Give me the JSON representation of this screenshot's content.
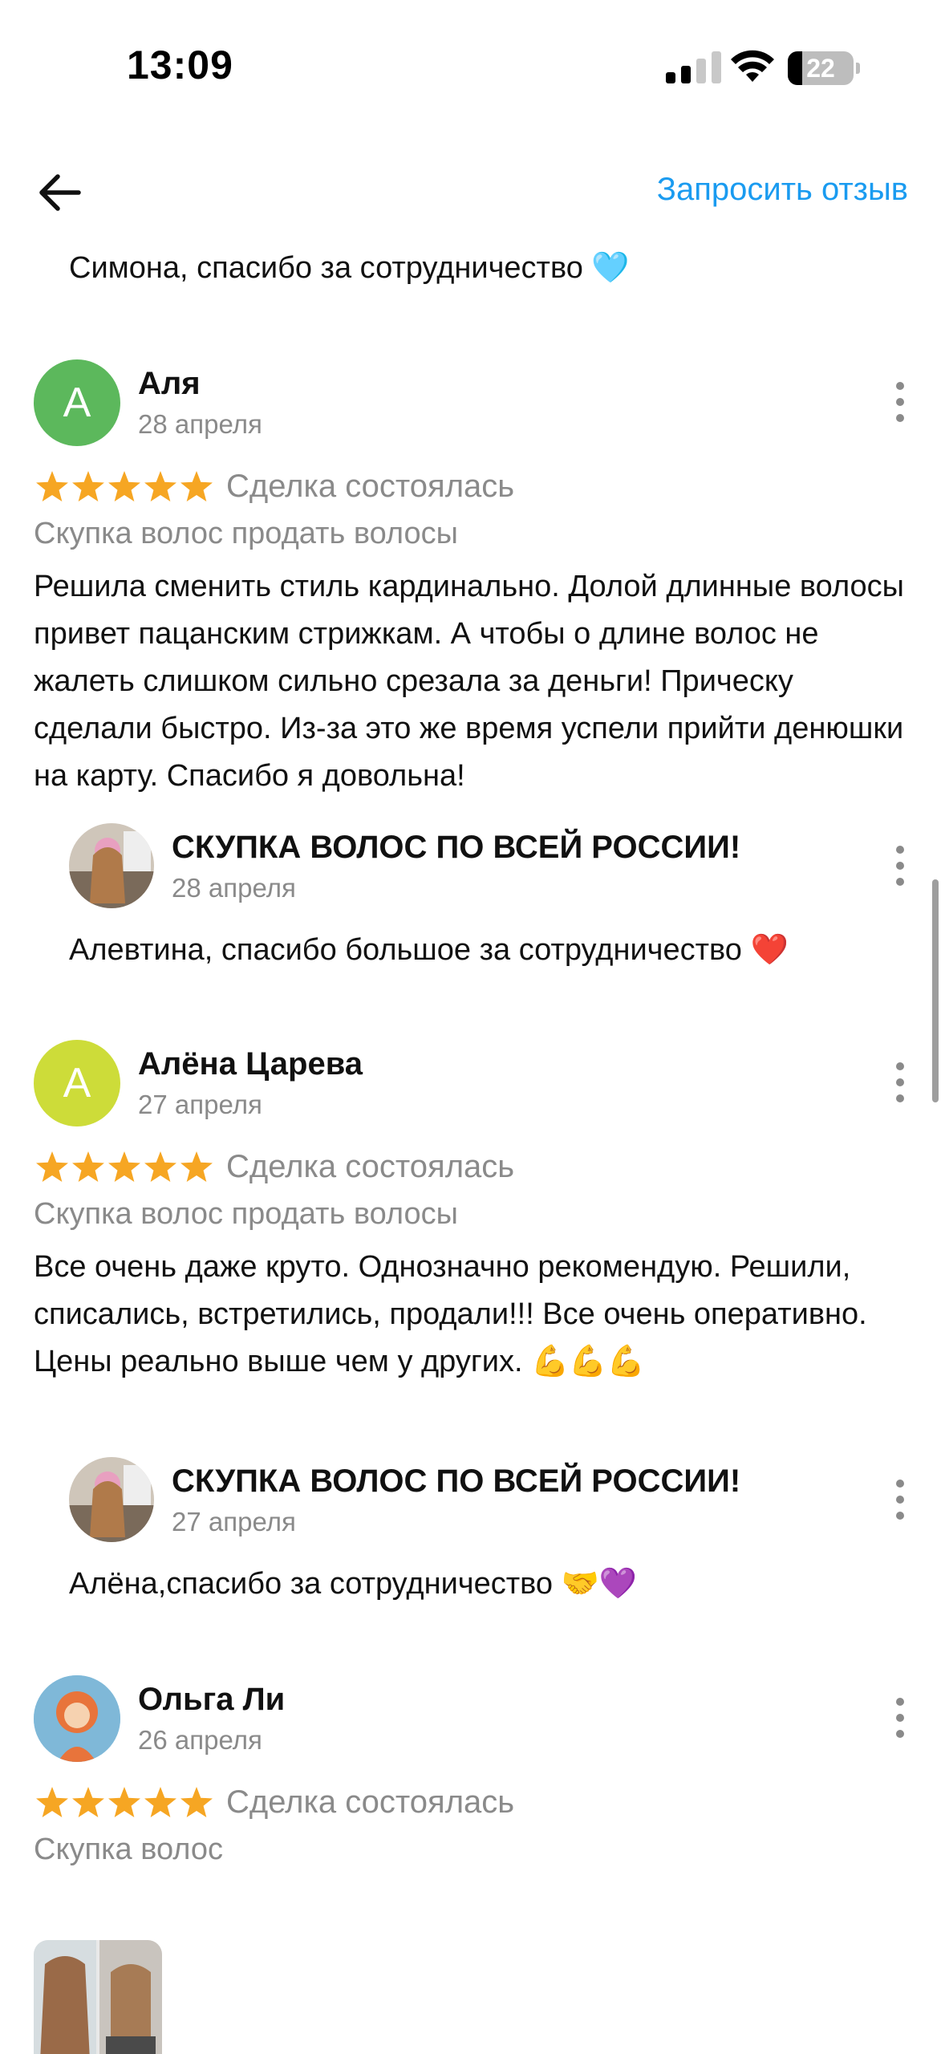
{
  "status_bar": {
    "time": "13:09",
    "battery": "22",
    "battery_level": 0.22
  },
  "header": {
    "back_icon": "arrow-left-icon",
    "request_review": "Запросить отзыв"
  },
  "previous_reply_tail": "Симона, спасибо за сотрудничество 🩵",
  "colors": {
    "accent": "#1a9bf0",
    "star": "#f6a623",
    "muted": "#8a8a8a"
  },
  "reviews": [
    {
      "avatar_letter": "А",
      "avatar_color": "#5cb85c",
      "author": "Аля",
      "date": "28 апреля",
      "rating": 5,
      "status": "Сделка состоялась",
      "service": "Скупка волос продать волосы",
      "text": "Решила сменить стиль кардинально. Долой длинные волосы привет пацанским стрижкам. А чтобы о длине волос не жалеть слишком сильно срезала за деньги! Прическу сделали быстро. Из-за это же время успели прийти денюшки на карту. Спасибо я довольна!",
      "reply": {
        "author": "СКУПКА ВОЛОС ПО ВСЕЙ РОССИИ!",
        "date": "28 апреля",
        "text": "Алевтина, спасибо большое за сотрудничество ❤️"
      }
    },
    {
      "avatar_letter": "А",
      "avatar_color": "#cddc39",
      "author": "Алёна Царева",
      "date": "27 апреля",
      "rating": 5,
      "status": "Сделка состоялась",
      "service": "Скупка волос продать волосы",
      "text": "Все очень даже круто. Однозначно рекомендую. Решили, списались, встретились, продали!!! Все очень оперативно. Цены реально выше чем у других. 💪💪💪",
      "reply": {
        "author": "СКУПКА ВОЛОС ПО ВСЕЙ РОССИИ!",
        "date": "27 апреля",
        "text": "Алёна,спасибо за сотрудничество 🤝💜"
      }
    },
    {
      "avatar_letter": "",
      "avatar_color": "#8ecae6",
      "author": "Ольга Ли",
      "date": "26 апреля",
      "rating": 5,
      "status": "Сделка состоялась",
      "service": "Скупка волос"
    }
  ]
}
